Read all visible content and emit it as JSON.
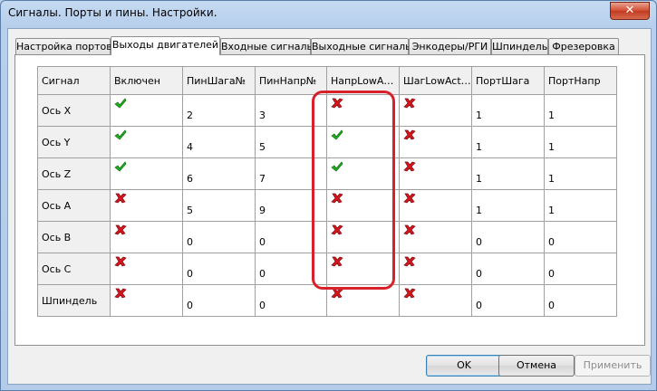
{
  "window": {
    "title": "Сигналы. Порты и пины. Настройки.",
    "close_symbol": "✕"
  },
  "tabs": [
    {
      "label": "Настройка портов"
    },
    {
      "label": "Выходы двигателей"
    },
    {
      "label": "Входные сигналы"
    },
    {
      "label": "Выходные сигналы"
    },
    {
      "label": "Энкодеры/РГИ"
    },
    {
      "label": "Шпиндель"
    },
    {
      "label": "Фрезеровка"
    }
  ],
  "active_tab": 1,
  "table": {
    "columns": [
      "Сигнал",
      "Включен",
      "ПинШага№",
      "ПинНапр№",
      "НапрLowA…",
      "ШагLowAct…",
      "ПортШага",
      "ПортНапр"
    ],
    "rows": [
      {
        "signal": "Ось X",
        "enabled": true,
        "step_pin": "2",
        "dir_pin": "3",
        "dir_low_active": false,
        "step_low_active": false,
        "step_port": "1",
        "dir_port": "1"
      },
      {
        "signal": "Ось Y",
        "enabled": true,
        "step_pin": "4",
        "dir_pin": "5",
        "dir_low_active": true,
        "step_low_active": false,
        "step_port": "1",
        "dir_port": "1"
      },
      {
        "signal": "Ось Z",
        "enabled": true,
        "step_pin": "6",
        "dir_pin": "7",
        "dir_low_active": true,
        "step_low_active": false,
        "step_port": "1",
        "dir_port": "1"
      },
      {
        "signal": "Ось A",
        "enabled": false,
        "step_pin": "5",
        "dir_pin": "9",
        "dir_low_active": false,
        "step_low_active": false,
        "step_port": "1",
        "dir_port": "1"
      },
      {
        "signal": "Ось B",
        "enabled": false,
        "step_pin": "0",
        "dir_pin": "0",
        "dir_low_active": false,
        "step_low_active": false,
        "step_port": "0",
        "dir_port": "0"
      },
      {
        "signal": "Ось C",
        "enabled": false,
        "step_pin": "0",
        "dir_pin": "0",
        "dir_low_active": false,
        "step_low_active": false,
        "step_port": "0",
        "dir_port": "0"
      },
      {
        "signal": "Шпиндель",
        "enabled": false,
        "step_pin": "0",
        "dir_pin": "0",
        "dir_low_active": false,
        "step_low_active": false,
        "step_port": "0",
        "dir_port": "0"
      }
    ],
    "icons": {
      "true": "green-check-icon",
      "false": "red-cross-icon"
    },
    "colors": {
      "check": "#1fb21f",
      "cross": "#d8141c",
      "highlight": "#d8222b"
    }
  },
  "buttons": {
    "ok": "OK",
    "cancel": "Отмена",
    "apply": "Применить"
  }
}
